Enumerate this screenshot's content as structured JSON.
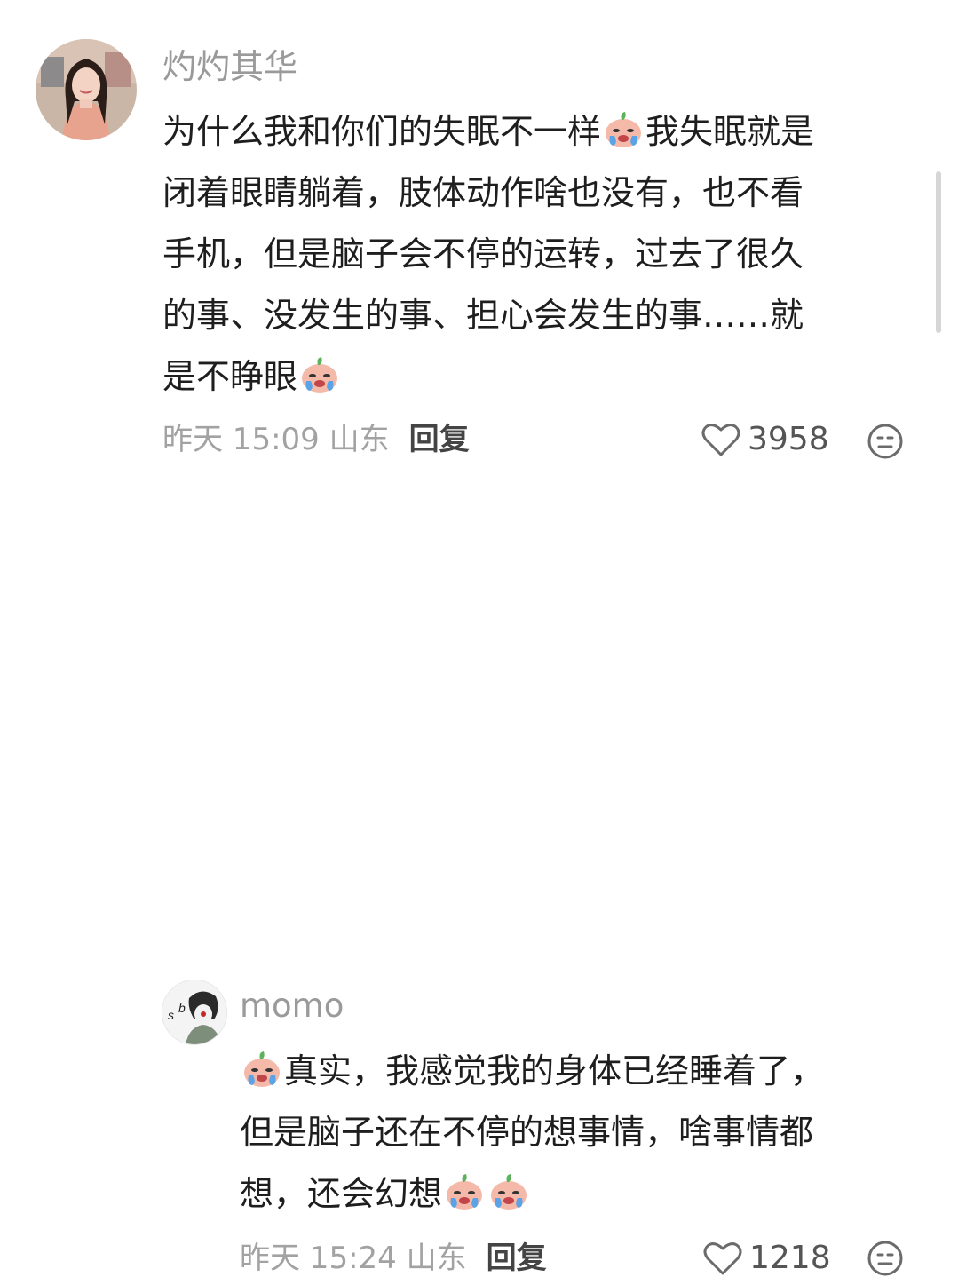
{
  "comments": [
    {
      "username": "灼灼其华",
      "lines": [
        {
          "before": "为什么我和你们的失眠不一样",
          "emoji": "crying-face",
          "after": "我失眠就是"
        },
        {
          "before": "闭着眼睛躺着，肢体动作啥也没有，也不看"
        },
        {
          "before": "手机，但是脑子会不停的运转，过去了很久"
        },
        {
          "before": "的事、没发生的事、担心会发生的事……就"
        },
        {
          "before": "是不睁眼",
          "emoji": "crying-face"
        }
      ],
      "time": "昨天 15:09 山东",
      "reply_label": "回复",
      "likes": "3958"
    },
    {
      "username": "momo",
      "avatar_text": "s b",
      "lines": [
        {
          "emoji": "crying-face",
          "before": "",
          "after": "真实，我感觉我的身体已经睡着了，"
        },
        {
          "before": "但是脑子还在不停的想事情，啥事情都"
        },
        {
          "before": "想，还会幻想",
          "emoji": "crying-face",
          "emoji2": "crying-face"
        }
      ],
      "time": "昨天 15:24 山东",
      "reply_label": "回复",
      "likes": "1218"
    }
  ],
  "colors": {
    "text": "#1e1e1e",
    "meta": "#a2a2a2",
    "username": "#9a9a9a"
  }
}
